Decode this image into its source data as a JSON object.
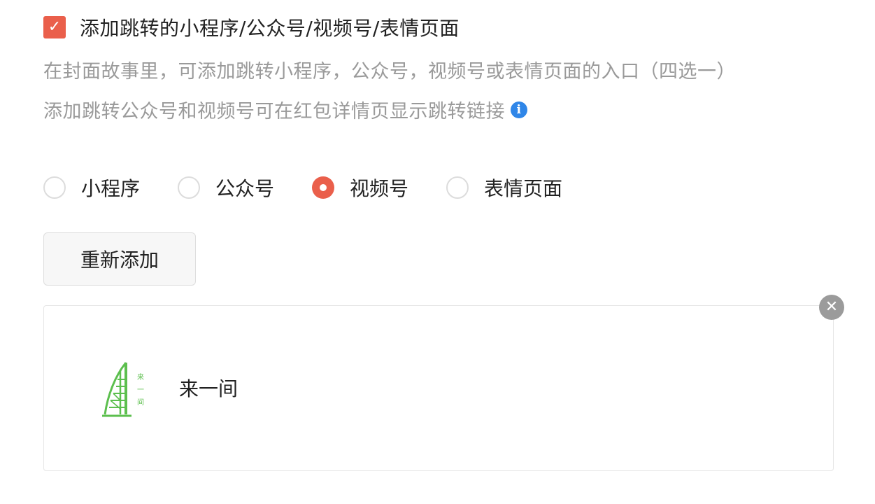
{
  "jump_section": {
    "checkbox_checked": true,
    "checkbox_label": "添加跳转的小程序/公众号/视频号/表情页面",
    "description_line1": "在封面故事里，可添加跳转小程序，公众号，视频号或表情页面的入口（四选一）",
    "description_line2": "添加跳转公众号和视频号可在红包详情页显示跳转链接",
    "info_icon": "info-icon"
  },
  "options": {
    "selected": "视频号",
    "items": [
      {
        "label": "小程序",
        "checked": false
      },
      {
        "label": "公众号",
        "checked": false
      },
      {
        "label": "视频号",
        "checked": true
      },
      {
        "label": "表情页面",
        "checked": false
      }
    ]
  },
  "readd_button": {
    "label": "重新添加"
  },
  "selected_account": {
    "name": "来一间",
    "avatar_text": "来一间",
    "avatar_icon": "building-logo-icon",
    "close_icon": "close-icon"
  },
  "colors": {
    "accent": "#ea5f4b",
    "info": "#2f86e8",
    "secondary_text": "#9a9a9a",
    "logo_green": "#5cbf4e"
  }
}
